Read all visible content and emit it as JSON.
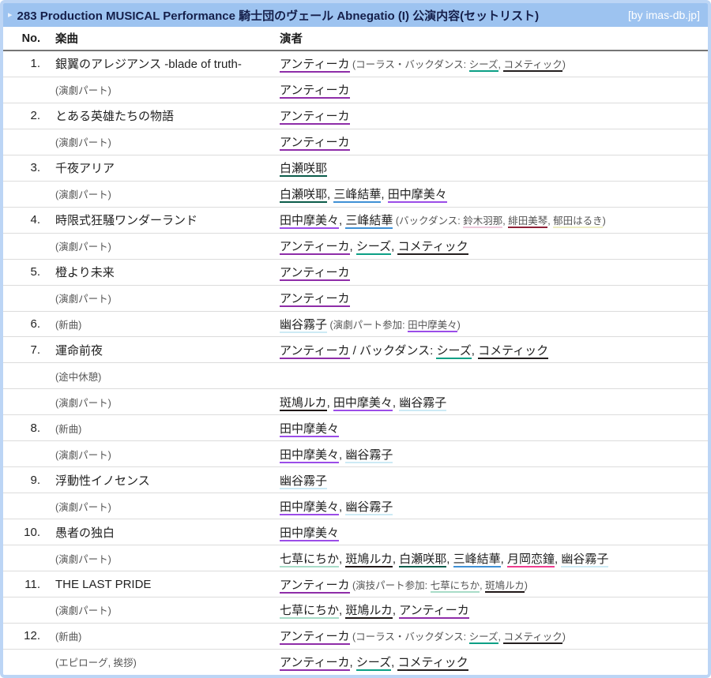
{
  "header": {
    "title": "283 Production MUSICAL Performance 騎士団のヴェール Abnegatio (I) 公演内容(セットリスト)",
    "byline": "[by imas-db.jp]",
    "bar_color": "#9dc3f0",
    "title_color": "#151f4a"
  },
  "columns": {
    "no": "No.",
    "song": "楽曲",
    "performer": "演者"
  },
  "colors": {
    "antica": "#8e2da8",
    "shhis": "#0c9f85",
    "cometik": "#241f1f",
    "sakuya": "#0b5c4a",
    "yuika": "#3f90d5",
    "mamimi": "#9b4de8",
    "kiriko": "#cdeaf5",
    "luca": "#1f1717",
    "nichika": "#a8dcc8",
    "kogane": "#ef3d8f",
    "hana": "#eec9db",
    "mikoto": "#8e2238",
    "haruki": "#eeedc3"
  },
  "rows": [
    {
      "no": "1.",
      "song": {
        "text": "銀翼のアレジアンス -blade of truth-",
        "style": "title"
      },
      "perf": [
        {
          "k": "l",
          "x": "アンティーカ",
          "c": "antica"
        },
        {
          "k": "st",
          "x": " (コーラス・バックダンス: "
        },
        {
          "k": "sl",
          "x": "シーズ",
          "c": "shhis"
        },
        {
          "k": "st",
          "x": ", "
        },
        {
          "k": "sl",
          "x": "コメティック",
          "c": "cometik"
        },
        {
          "k": "st",
          "x": ")"
        }
      ]
    },
    {
      "no": "",
      "song": {
        "text": "(演劇パート)",
        "style": "sub"
      },
      "perf": [
        {
          "k": "l",
          "x": "アンティーカ",
          "c": "antica"
        }
      ]
    },
    {
      "no": "2.",
      "song": {
        "text": "とある英雄たちの物語",
        "style": "title"
      },
      "perf": [
        {
          "k": "l",
          "x": "アンティーカ",
          "c": "antica"
        }
      ]
    },
    {
      "no": "",
      "song": {
        "text": "(演劇パート)",
        "style": "sub"
      },
      "perf": [
        {
          "k": "l",
          "x": "アンティーカ",
          "c": "antica"
        }
      ]
    },
    {
      "no": "3.",
      "song": {
        "text": "千夜アリア",
        "style": "title"
      },
      "perf": [
        {
          "k": "l",
          "x": "白瀬咲耶",
          "c": "sakuya"
        }
      ]
    },
    {
      "no": "",
      "song": {
        "text": "(演劇パート)",
        "style": "sub"
      },
      "perf": [
        {
          "k": "l",
          "x": "白瀬咲耶",
          "c": "sakuya"
        },
        {
          "k": "t",
          "x": ", "
        },
        {
          "k": "l",
          "x": "三峰結華",
          "c": "yuika"
        },
        {
          "k": "t",
          "x": ", "
        },
        {
          "k": "l",
          "x": "田中摩美々",
          "c": "mamimi"
        }
      ]
    },
    {
      "no": "4.",
      "song": {
        "text": "時限式狂騒ワンダーランド",
        "style": "title"
      },
      "perf": [
        {
          "k": "l",
          "x": "田中摩美々",
          "c": "mamimi"
        },
        {
          "k": "t",
          "x": ", "
        },
        {
          "k": "l",
          "x": "三峰結華",
          "c": "yuika"
        },
        {
          "k": "st",
          "x": " (バックダンス: "
        },
        {
          "k": "sl",
          "x": "鈴木羽那",
          "c": "hana"
        },
        {
          "k": "st",
          "x": ", "
        },
        {
          "k": "sl",
          "x": "緋田美琴",
          "c": "mikoto"
        },
        {
          "k": "st",
          "x": ", "
        },
        {
          "k": "sl",
          "x": "郁田はるき",
          "c": "haruki"
        },
        {
          "k": "st",
          "x": ")"
        }
      ]
    },
    {
      "no": "",
      "song": {
        "text": "(演劇パート)",
        "style": "sub"
      },
      "perf": [
        {
          "k": "l",
          "x": "アンティーカ",
          "c": "antica"
        },
        {
          "k": "t",
          "x": ", "
        },
        {
          "k": "l",
          "x": "シーズ",
          "c": "shhis"
        },
        {
          "k": "t",
          "x": ", "
        },
        {
          "k": "l",
          "x": "コメティック",
          "c": "cometik"
        }
      ]
    },
    {
      "no": "5.",
      "song": {
        "text": "橙より未来",
        "style": "title"
      },
      "perf": [
        {
          "k": "l",
          "x": "アンティーカ",
          "c": "antica"
        }
      ]
    },
    {
      "no": "",
      "song": {
        "text": "(演劇パート)",
        "style": "sub"
      },
      "perf": [
        {
          "k": "l",
          "x": "アンティーカ",
          "c": "antica"
        }
      ]
    },
    {
      "no": "6.",
      "song": {
        "text": "(新曲)",
        "style": "sub"
      },
      "perf": [
        {
          "k": "l",
          "x": "幽谷霧子",
          "c": "kiriko"
        },
        {
          "k": "st",
          "x": " (演劇パート参加: "
        },
        {
          "k": "sl",
          "x": "田中摩美々",
          "c": "mamimi"
        },
        {
          "k": "st",
          "x": ")"
        }
      ]
    },
    {
      "no": "7.",
      "song": {
        "text": "運命前夜",
        "style": "title"
      },
      "perf": [
        {
          "k": "l",
          "x": "アンティーカ",
          "c": "antica"
        },
        {
          "k": "t",
          "x": " / バックダンス: "
        },
        {
          "k": "l",
          "x": "シーズ",
          "c": "shhis"
        },
        {
          "k": "t",
          "x": ", "
        },
        {
          "k": "l",
          "x": "コメティック",
          "c": "cometik"
        }
      ]
    },
    {
      "no": "",
      "song": {
        "text": "(途中休憩)",
        "style": "sub"
      },
      "perf": []
    },
    {
      "no": "",
      "song": {
        "text": "(演劇パート)",
        "style": "sub"
      },
      "perf": [
        {
          "k": "l",
          "x": "斑鳩ルカ",
          "c": "luca"
        },
        {
          "k": "t",
          "x": ", "
        },
        {
          "k": "l",
          "x": "田中摩美々",
          "c": "mamimi"
        },
        {
          "k": "t",
          "x": ", "
        },
        {
          "k": "l",
          "x": "幽谷霧子",
          "c": "kiriko"
        }
      ]
    },
    {
      "no": "8.",
      "song": {
        "text": "(新曲)",
        "style": "sub"
      },
      "perf": [
        {
          "k": "l",
          "x": "田中摩美々",
          "c": "mamimi"
        }
      ]
    },
    {
      "no": "",
      "song": {
        "text": "(演劇パート)",
        "style": "sub"
      },
      "perf": [
        {
          "k": "l",
          "x": "田中摩美々",
          "c": "mamimi"
        },
        {
          "k": "t",
          "x": ", "
        },
        {
          "k": "l",
          "x": "幽谷霧子",
          "c": "kiriko"
        }
      ]
    },
    {
      "no": "9.",
      "song": {
        "text": "浮動性イノセンス",
        "style": "title"
      },
      "perf": [
        {
          "k": "l",
          "x": "幽谷霧子",
          "c": "kiriko"
        }
      ]
    },
    {
      "no": "",
      "song": {
        "text": "(演劇パート)",
        "style": "sub"
      },
      "perf": [
        {
          "k": "l",
          "x": "田中摩美々",
          "c": "mamimi"
        },
        {
          "k": "t",
          "x": ", "
        },
        {
          "k": "l",
          "x": "幽谷霧子",
          "c": "kiriko"
        }
      ]
    },
    {
      "no": "10.",
      "song": {
        "text": "愚者の独白",
        "style": "title"
      },
      "perf": [
        {
          "k": "l",
          "x": "田中摩美々",
          "c": "mamimi"
        }
      ]
    },
    {
      "no": "",
      "song": {
        "text": "(演劇パート)",
        "style": "sub"
      },
      "perf": [
        {
          "k": "l",
          "x": "七草にちか",
          "c": "nichika"
        },
        {
          "k": "t",
          "x": ", "
        },
        {
          "k": "l",
          "x": "斑鳩ルカ",
          "c": "luca"
        },
        {
          "k": "t",
          "x": ", "
        },
        {
          "k": "l",
          "x": "白瀬咲耶",
          "c": "sakuya"
        },
        {
          "k": "t",
          "x": ", "
        },
        {
          "k": "l",
          "x": "三峰結華",
          "c": "yuika"
        },
        {
          "k": "t",
          "x": ", "
        },
        {
          "k": "l",
          "x": "月岡恋鐘",
          "c": "kogane"
        },
        {
          "k": "t",
          "x": ", "
        },
        {
          "k": "l",
          "x": "幽谷霧子",
          "c": "kiriko"
        }
      ]
    },
    {
      "no": "11.",
      "song": {
        "text": "THE LAST PRIDE",
        "style": "title"
      },
      "perf": [
        {
          "k": "l",
          "x": "アンティーカ",
          "c": "antica"
        },
        {
          "k": "st",
          "x": " (演技パート参加: "
        },
        {
          "k": "sl",
          "x": "七草にちか",
          "c": "nichika"
        },
        {
          "k": "st",
          "x": ", "
        },
        {
          "k": "sl",
          "x": "斑鳩ルカ",
          "c": "luca"
        },
        {
          "k": "st",
          "x": ")"
        }
      ]
    },
    {
      "no": "",
      "song": {
        "text": "(演劇パート)",
        "style": "sub"
      },
      "perf": [
        {
          "k": "l",
          "x": "七草にちか",
          "c": "nichika"
        },
        {
          "k": "t",
          "x": ", "
        },
        {
          "k": "l",
          "x": "斑鳩ルカ",
          "c": "luca"
        },
        {
          "k": "t",
          "x": ", "
        },
        {
          "k": "l",
          "x": "アンティーカ",
          "c": "antica"
        }
      ]
    },
    {
      "no": "12.",
      "song": {
        "text": "(新曲)",
        "style": "sub"
      },
      "perf": [
        {
          "k": "l",
          "x": "アンティーカ",
          "c": "antica"
        },
        {
          "k": "st",
          "x": " (コーラス・バックダンス: "
        },
        {
          "k": "sl",
          "x": "シーズ",
          "c": "shhis"
        },
        {
          "k": "st",
          "x": ", "
        },
        {
          "k": "sl",
          "x": "コメティック",
          "c": "cometik"
        },
        {
          "k": "st",
          "x": ")"
        }
      ]
    },
    {
      "no": "",
      "song": {
        "text": "(エピローグ, 挨拶)",
        "style": "sub"
      },
      "perf": [
        {
          "k": "l",
          "x": "アンティーカ",
          "c": "antica"
        },
        {
          "k": "t",
          "x": ", "
        },
        {
          "k": "l",
          "x": "シーズ",
          "c": "shhis"
        },
        {
          "k": "t",
          "x": ", "
        },
        {
          "k": "l",
          "x": "コメティック",
          "c": "cometik"
        }
      ]
    }
  ]
}
